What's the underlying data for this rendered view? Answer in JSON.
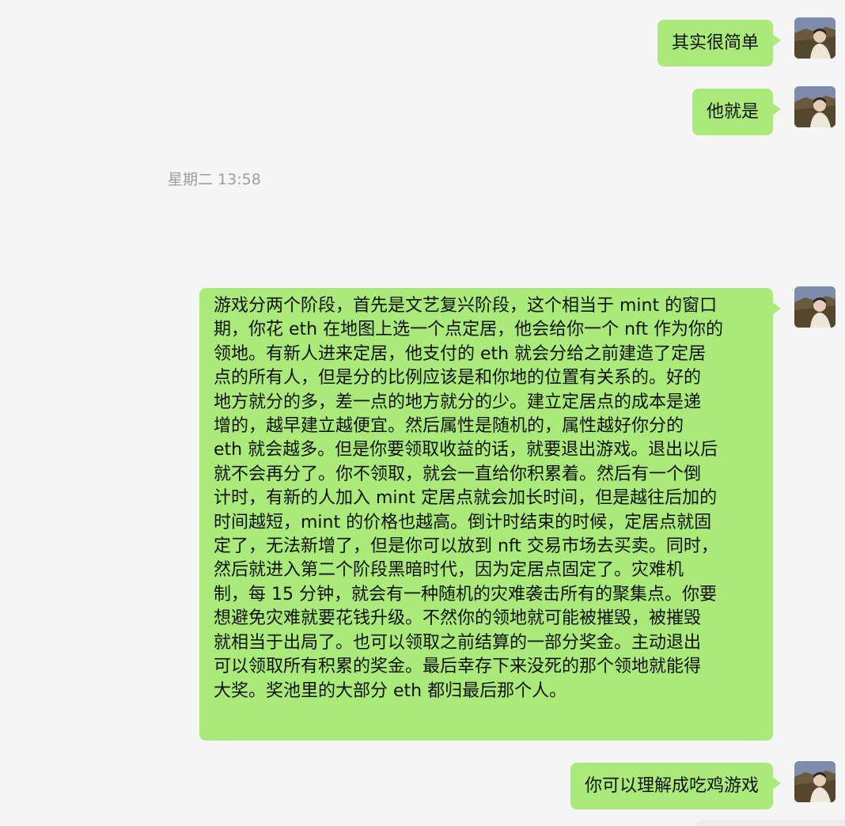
{
  "messages": [
    {
      "sender": "me",
      "type": "text",
      "text": "其实很简单"
    },
    {
      "sender": "me",
      "type": "text",
      "text": "他就是"
    },
    {
      "type": "timestamp",
      "text": "星期二 13:58"
    },
    {
      "sender": "me",
      "type": "text",
      "lines": [
        "游戏分两个阶段，首先是文艺复兴阶段，这个相当于 mint 的窗口",
        "期，你花 eth 在地图上选一个点定居，他会给你一个 nft 作为你的",
        "领地。有新人进来定居，他支付的 eth 就会分给之前建造了定居",
        "点的所有人，但是分的比例应该是和你地的位置有关系的。好的",
        "地方就分的多，差一点的地方就分的少。建立定居点的成本是递",
        "增的，越早建立越便宜。然后属性是随机的，属性越好你分的",
        "eth 就会越多。但是你要领取收益的话，就要退出游戏。退出以后",
        "就不会再分了。你不领取，就会一直给你积累着。然后有一个倒",
        "计时，有新的人加入 mint 定居点就会加长时间，但是越往后加的",
        "时间越短，mint 的价格也越高。倒计时结束的时候，定居点就固",
        "定了，无法新增了，但是你可以放到 nft 交易市场去买卖。同时，",
        "然后就进入第二个阶段黑暗时代，因为定居点固定了。灾难机",
        "制，每 15 分钟，就会有一种随机的灾难袭击所有的聚集点。你要",
        "想避免灾难就要花钱升级。不然你的领地就可能被摧毁，被摧毁",
        "就相当于出局了。也可以领取之前结算的一部分奖金。主动退出",
        "可以领取所有积累的奖金。最后幸存下来没死的那个领地就能得",
        "大奖。奖池里的大部分 eth 都归最后那个人。"
      ]
    },
    {
      "sender": "me",
      "type": "text",
      "text": "你可以理解成吃鸡游戏"
    }
  ],
  "colors": {
    "background": "#f5f5f5",
    "bubble_self": "#a9ea7a",
    "timestamp_text": "#9d9d9d"
  },
  "icons": {
    "avatar": "user-avatar-photo"
  }
}
